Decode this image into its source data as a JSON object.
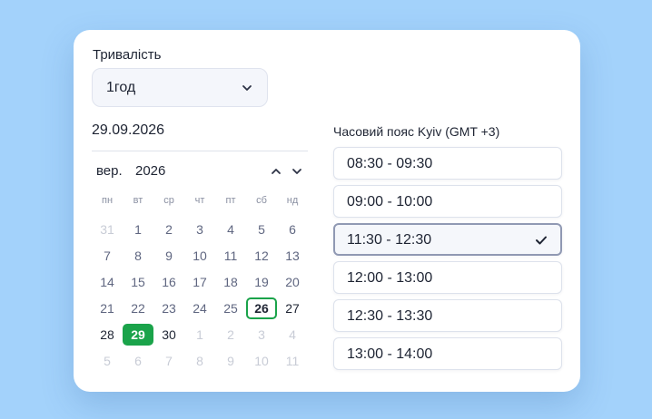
{
  "duration": {
    "label": "Тривалість",
    "value": "1год"
  },
  "selected_date": "29.09.2026",
  "calendar": {
    "month": "вер.",
    "year": "2026",
    "weekdays": [
      "пн",
      "вт",
      "ср",
      "чт",
      "пт",
      "сб",
      "нд"
    ],
    "days": [
      {
        "d": "31",
        "t": "dim"
      },
      {
        "d": "1",
        "t": "cur"
      },
      {
        "d": "2",
        "t": "cur"
      },
      {
        "d": "3",
        "t": "cur"
      },
      {
        "d": "4",
        "t": "cur"
      },
      {
        "d": "5",
        "t": "cur"
      },
      {
        "d": "6",
        "t": "cur"
      },
      {
        "d": "7",
        "t": "cur"
      },
      {
        "d": "8",
        "t": "cur"
      },
      {
        "d": "9",
        "t": "cur"
      },
      {
        "d": "10",
        "t": "cur"
      },
      {
        "d": "11",
        "t": "cur"
      },
      {
        "d": "12",
        "t": "cur"
      },
      {
        "d": "13",
        "t": "cur"
      },
      {
        "d": "14",
        "t": "cur"
      },
      {
        "d": "15",
        "t": "cur"
      },
      {
        "d": "16",
        "t": "cur"
      },
      {
        "d": "17",
        "t": "cur"
      },
      {
        "d": "18",
        "t": "cur"
      },
      {
        "d": "19",
        "t": "cur"
      },
      {
        "d": "20",
        "t": "cur"
      },
      {
        "d": "21",
        "t": "cur"
      },
      {
        "d": "22",
        "t": "cur"
      },
      {
        "d": "23",
        "t": "cur"
      },
      {
        "d": "24",
        "t": "cur"
      },
      {
        "d": "25",
        "t": "cur"
      },
      {
        "d": "26",
        "t": "today"
      },
      {
        "d": "27",
        "t": "bold"
      },
      {
        "d": "28",
        "t": "bold"
      },
      {
        "d": "29",
        "t": "selected"
      },
      {
        "d": "30",
        "t": "bold"
      },
      {
        "d": "1",
        "t": "dim"
      },
      {
        "d": "2",
        "t": "dim"
      },
      {
        "d": "3",
        "t": "dim"
      },
      {
        "d": "4",
        "t": "dim"
      },
      {
        "d": "5",
        "t": "dim"
      },
      {
        "d": "6",
        "t": "dim"
      },
      {
        "d": "7",
        "t": "dim"
      },
      {
        "d": "8",
        "t": "dim"
      },
      {
        "d": "9",
        "t": "dim"
      },
      {
        "d": "10",
        "t": "dim"
      },
      {
        "d": "11",
        "t": "dim"
      }
    ]
  },
  "timezone_label": "Часовий пояс Kyiv (GMT +3)",
  "time_slots": [
    {
      "label": "08:30 - 09:30",
      "selected": false
    },
    {
      "label": "09:00 - 10:00",
      "selected": false
    },
    {
      "label": "11:30 - 12:30",
      "selected": true
    },
    {
      "label": "12:00 - 13:00",
      "selected": false
    },
    {
      "label": "12:30 - 13:30",
      "selected": false
    },
    {
      "label": "13:00 - 14:00",
      "selected": false
    }
  ],
  "icons": {
    "duration_dropdown": "chevron-down-icon",
    "month_prev": "chevron-up-icon",
    "month_next": "chevron-down-icon",
    "slot_selected": "check-icon"
  },
  "colors": {
    "accent": "#1aa34a",
    "background": "#a3d2fb",
    "selected_slot_border": "#9099b3"
  }
}
